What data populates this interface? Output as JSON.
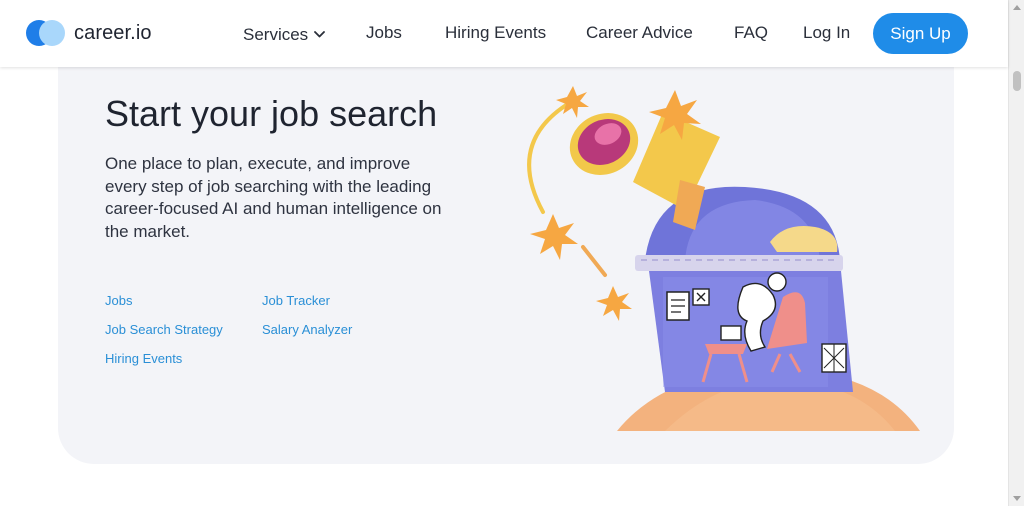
{
  "header": {
    "logo_text": "career.io",
    "nav": {
      "services": "Services",
      "jobs": "Jobs",
      "hiring_events": "Hiring Events",
      "career_advice": "Career Advice",
      "faq": "FAQ",
      "login": "Log In"
    },
    "signup_label": "Sign Up"
  },
  "hero": {
    "title": "Start your job search",
    "description": "One place to plan, execute, and improve every step of job searching with the leading career-focused AI and human intelligence on the market.",
    "links": {
      "jobs": "Jobs",
      "job_search_strategy": "Job Search Strategy",
      "hiring_events": "Hiring Events",
      "job_tracker": "Job Tracker",
      "salary_analyzer": "Salary Analyzer"
    }
  },
  "colors": {
    "accent": "#1f8ce8",
    "link": "#2a8fd6",
    "card_bg": "#f3f4f8",
    "logo_dark": "#1f7ee8",
    "logo_light": "#a9d7fb"
  }
}
